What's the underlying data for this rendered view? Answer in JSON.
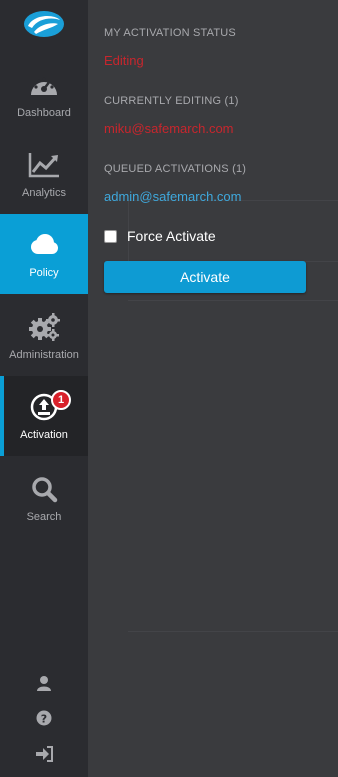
{
  "nav": {
    "items": [
      {
        "label": "Dashboard",
        "icon": "dashboard-gauge-icon"
      },
      {
        "label": "Analytics",
        "icon": "analytics-chart-icon"
      },
      {
        "label": "Policy",
        "icon": "cloud-icon"
      },
      {
        "label": "Administration",
        "icon": "gears-icon"
      },
      {
        "label": "Activation",
        "icon": "upload-icon",
        "badge": "1"
      },
      {
        "label": "Search",
        "icon": "search-icon"
      }
    ],
    "bottom_icons": [
      "user-icon",
      "help-icon",
      "logout-icon"
    ]
  },
  "panel": {
    "my_status_title": "MY ACTIVATION STATUS",
    "my_status_value": "Editing",
    "editing_title": "CURRENTLY EDITING (1)",
    "editing_user": "miku@safemarch.com",
    "queued_title": "QUEUED ACTIVATIONS (1)",
    "queued_user": "admin@safemarch.com",
    "force_label": "Force Activate",
    "force_checked": false,
    "activate_label": "Activate"
  },
  "colors": {
    "accent": "#0a9fd6",
    "status_red": "#c8262d",
    "link_blue": "#3fa9dd",
    "badge_red": "#d8202a"
  }
}
